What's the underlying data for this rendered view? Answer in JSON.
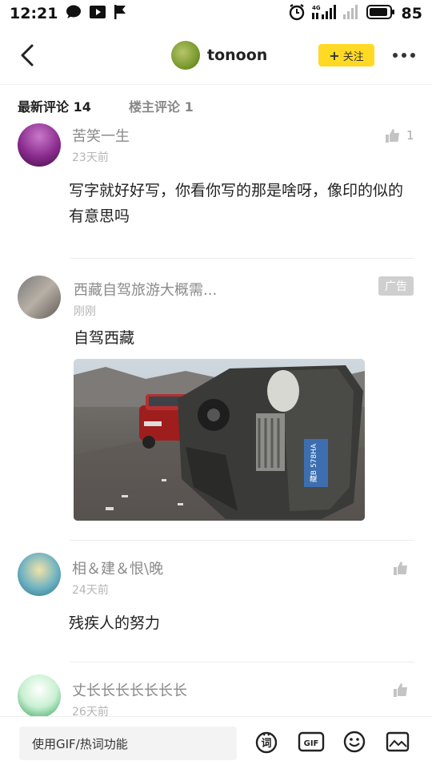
{
  "status": {
    "time": "12:21",
    "battery": "85",
    "network": "4G"
  },
  "header": {
    "username": "tonoon",
    "follow_label": "关注"
  },
  "tabs": {
    "latest": "最新评论 14",
    "owner": "楼主评论 1"
  },
  "comments": [
    {
      "name": "苦笑一生",
      "time": "23天前",
      "text": "写字就好好写，你看你写的那是啥呀，像印的似的有意思吗",
      "likes": "1"
    },
    {
      "name": "相＆建＆恨\\晚",
      "time": "24天前",
      "text": "残疾人的努力",
      "likes": ""
    },
    {
      "name": "丈长长长长长长长",
      "time": "26天前",
      "text": "",
      "likes": ""
    }
  ],
  "ad": {
    "title": "西藏自驾旅游大概需...",
    "time": "刚刚",
    "badge": "广告",
    "text": "自驾西藏",
    "plate": "藏B 578HA"
  },
  "bottom": {
    "input_placeholder": "使用GIF/热词功能",
    "word_label": "词",
    "gif_label": "GIF"
  }
}
